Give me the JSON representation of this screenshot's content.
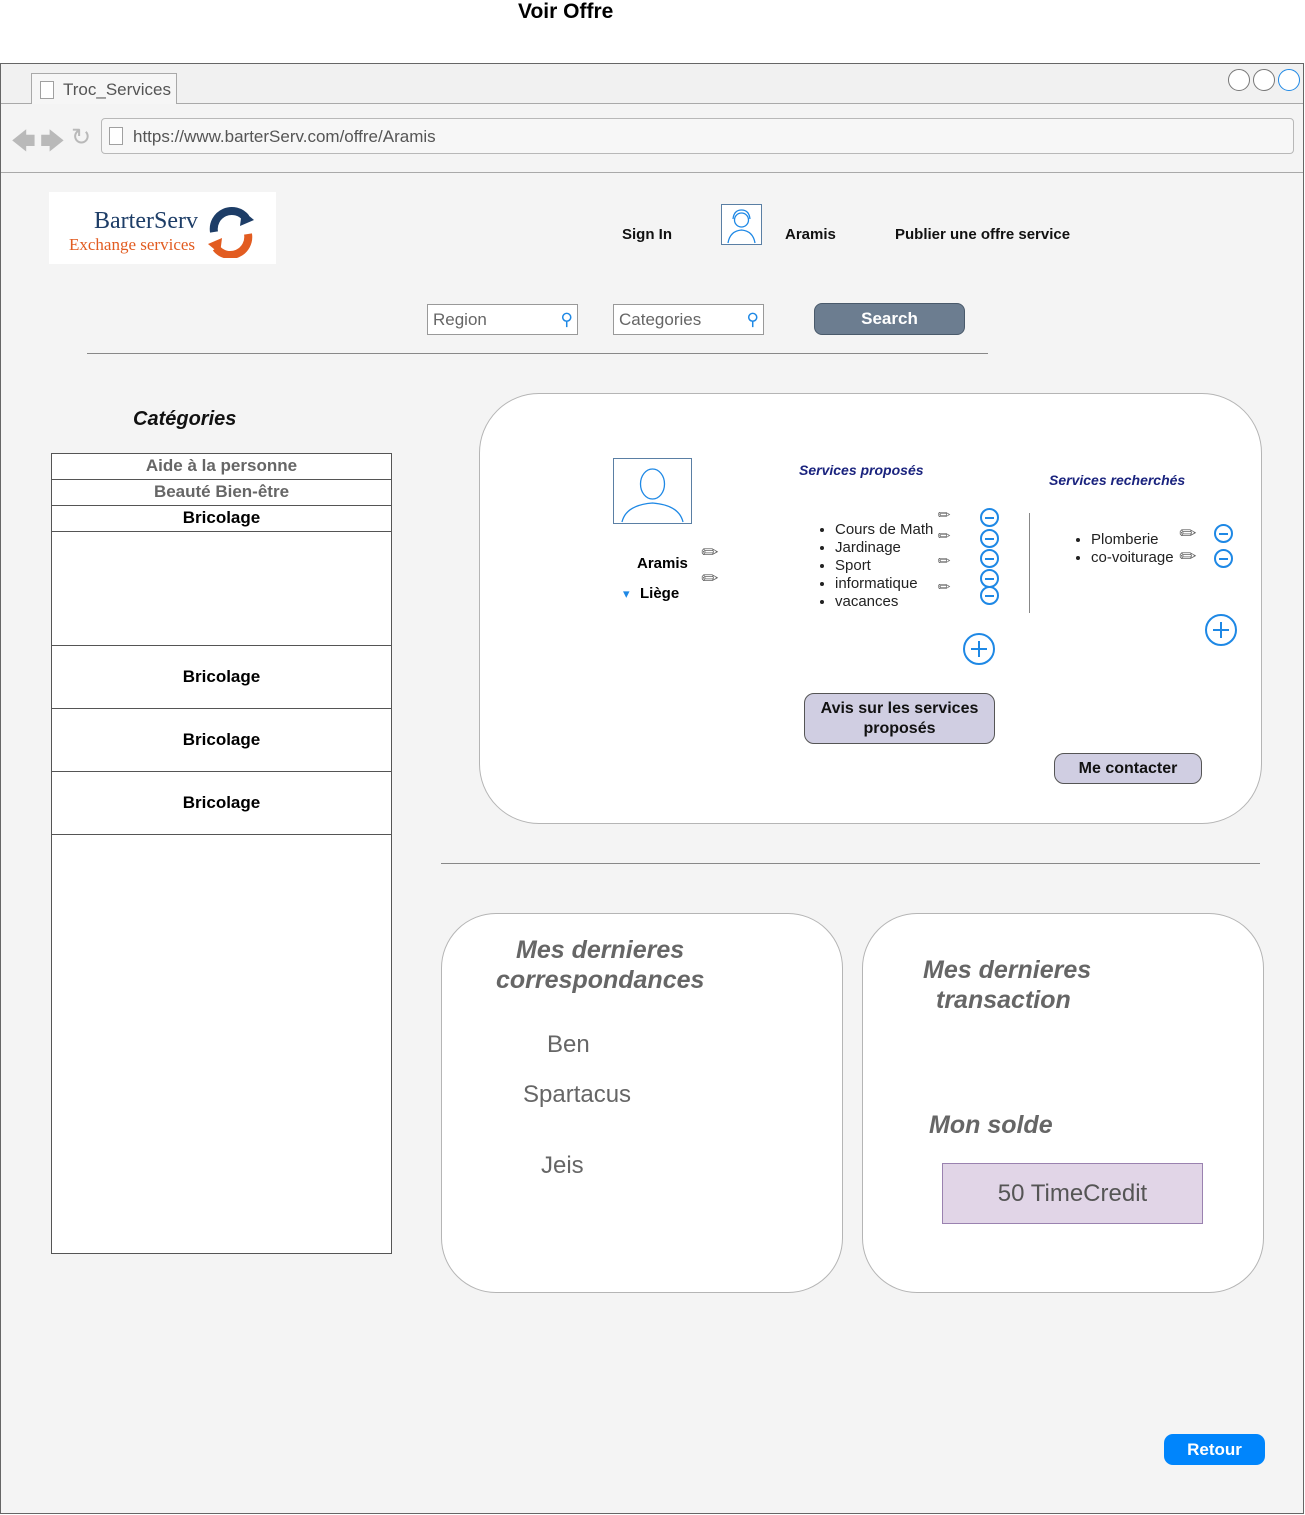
{
  "page": {
    "title": "Voir Offre"
  },
  "browser": {
    "tab_label": "Troc_Services",
    "url": "https://www.barterServ.com/offre/Aramis"
  },
  "header": {
    "logo_line1": "BarterServ",
    "logo_line2": "Exchange services",
    "sign_in": "Sign In",
    "username": "Aramis",
    "publish": "Publier une offre service"
  },
  "search": {
    "region_placeholder": "Region",
    "categories_placeholder": "Categories",
    "button": "Search"
  },
  "categories": {
    "title": "Catégories",
    "items": [
      "Aide à la personne",
      "Beauté Bien-être",
      "Bricolage",
      "Bricolage",
      "Bricolage",
      "Bricolage"
    ]
  },
  "profile": {
    "name": "Aramis",
    "location": "Liège",
    "offered_title": "Services proposés",
    "offered": [
      "Cours de Math",
      "Jardinage",
      "Sport",
      "informatique",
      "vacances"
    ],
    "wanted_title": "Services recherchés",
    "wanted": [
      "Plomberie",
      "co-voiturage"
    ],
    "reviews_button": "Avis sur les services proposés",
    "contact_button": "Me contacter"
  },
  "correspondence": {
    "title_line1": "Mes dernieres",
    "title_line2": "correspondances",
    "names": [
      "Ben",
      "Spartacus",
      "Jeis"
    ]
  },
  "transactions": {
    "title_line1": "Mes dernieres",
    "title_line2": "transaction",
    "balance_title": "Mon solde",
    "balance": "50 TimeCredit"
  },
  "footer": {
    "back_button": "Retour"
  },
  "colors": {
    "accent": "#1e88e5",
    "search_button": "#6c7d90",
    "back_button": "#0085fc",
    "pill": "#d0cee2",
    "balance_bg": "#e1d5e7"
  }
}
